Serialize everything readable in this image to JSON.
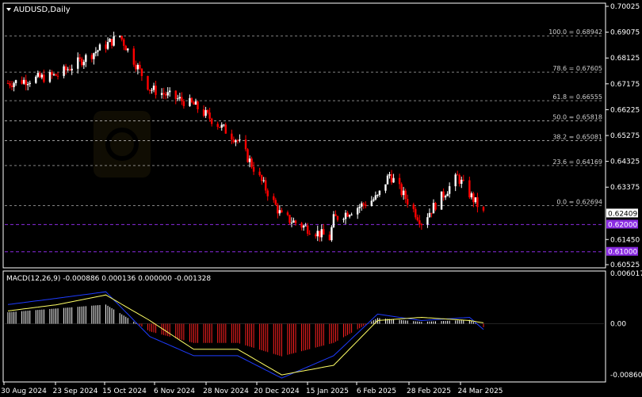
{
  "header": {
    "symbol_timeframe": "AUDUSD,Daily",
    "dropdown_icon": "triangle-down-icon"
  },
  "price_axis": {
    "labels": [
      "0.70025",
      "0.69075",
      "0.68125",
      "0.67175",
      "0.66225",
      "0.65275",
      "0.64325",
      "0.63375",
      "0.62409",
      "0.61450",
      "0.60525"
    ],
    "current_price": "0.62409",
    "current_price_color": "#ffffff"
  },
  "fibonacci": {
    "levels": [
      {
        "label": "100.0 = 0.68942",
        "price": 0.68942
      },
      {
        "label": "78.6 = 0.67605",
        "price": 0.67605
      },
      {
        "label": "61.8 = 0.66555",
        "price": 0.66555
      },
      {
        "label": "50.0 = 0.65818",
        "price": 0.65818
      },
      {
        "label": "38.2 = 0.65081",
        "price": 0.65081
      },
      {
        "label": "23.6 = 0.64169",
        "price": 0.64169
      },
      {
        "label": "0.0 = 0.62694",
        "price": 0.62694
      }
    ],
    "color": "#cfcfcf"
  },
  "horizontal_lines": [
    {
      "label": "0.62000",
      "price": 0.62,
      "color": "#8a2be2"
    },
    {
      "label": "0.61000",
      "price": 0.61,
      "color": "#8a2be2"
    }
  ],
  "macd": {
    "label": "MACD(12,26,9) -0.000886 0.000136 0.000000 -0.001328",
    "axis_labels": [
      "0.006017",
      "0.00",
      "-0.008609"
    ],
    "macd_line_color": "#1e3cff",
    "signal_line_color": "#ffff66"
  },
  "time_axis": {
    "labels": [
      "30 Aug 2024",
      "23 Sep 2024",
      "15 Oct 2024",
      "6 Nov 2024",
      "28 Nov 2024",
      "20 Dec 2024",
      "15 Jan 2025",
      "6 Feb 2025",
      "28 Feb 2025",
      "24 Mar 2025"
    ]
  },
  "colors": {
    "background": "#000000",
    "bull_candle": "#ffffff",
    "bear_candle": "#ff0000",
    "grid": "#3a3a3a",
    "axis_text": "#ffffff"
  },
  "chart_data": {
    "type": "candlestick",
    "title": "AUDUSD,Daily",
    "ylim": [
      0.60525,
      0.70025
    ],
    "close_anchors": [
      {
        "date": "30 Aug 2024",
        "close": 0.675
      },
      {
        "date": "23 Sep 2024",
        "close": 0.686
      },
      {
        "date": "30 Sep 2024",
        "close": 0.6894
      },
      {
        "date": "15 Oct 2024",
        "close": 0.67
      },
      {
        "date": "6 Nov 2024",
        "close": 0.664
      },
      {
        "date": "28 Nov 2024",
        "close": 0.651
      },
      {
        "date": "20 Dec 2024",
        "close": 0.623
      },
      {
        "date": "13 Jan 2025",
        "close": 0.615
      },
      {
        "date": "15 Jan 2025",
        "close": 0.622
      },
      {
        "date": "6 Feb 2025",
        "close": 0.63
      },
      {
        "date": "12 Feb 2025",
        "close": 0.6385
      },
      {
        "date": "28 Feb 2025",
        "close": 0.621
      },
      {
        "date": "18 Mar 2025",
        "close": 0.6375
      },
      {
        "date": "31 Mar 2025",
        "close": 0.62409
      }
    ],
    "macd_anchors": [
      {
        "date": "30 Aug 2024",
        "macd": 0.004,
        "signal": 0.003
      },
      {
        "date": "23 Sep 2024",
        "macd": 0.005,
        "signal": 0.0045
      },
      {
        "date": "15 Oct 2024",
        "macd": -0.002,
        "signal": 0.0005
      },
      {
        "date": "6 Nov 2024",
        "macd": -0.005,
        "signal": -0.004
      },
      {
        "date": "28 Nov 2024",
        "macd": -0.005,
        "signal": -0.004
      },
      {
        "date": "20 Dec 2024",
        "macd": -0.0085,
        "signal": -0.008
      },
      {
        "date": "15 Jan 2025",
        "macd": -0.005,
        "signal": -0.0065
      },
      {
        "date": "6 Feb 2025",
        "macd": 0.0015,
        "signal": 0.0005
      },
      {
        "date": "28 Feb 2025",
        "macd": 0.0005,
        "signal": 0.001
      },
      {
        "date": "24 Mar 2025",
        "macd": 0.001,
        "signal": 0.0005
      },
      {
        "date": "31 Mar 2025",
        "macd": -0.000886,
        "signal": 0.000136
      }
    ],
    "macd_ylim": [
      -0.008609,
      0.006017
    ]
  }
}
